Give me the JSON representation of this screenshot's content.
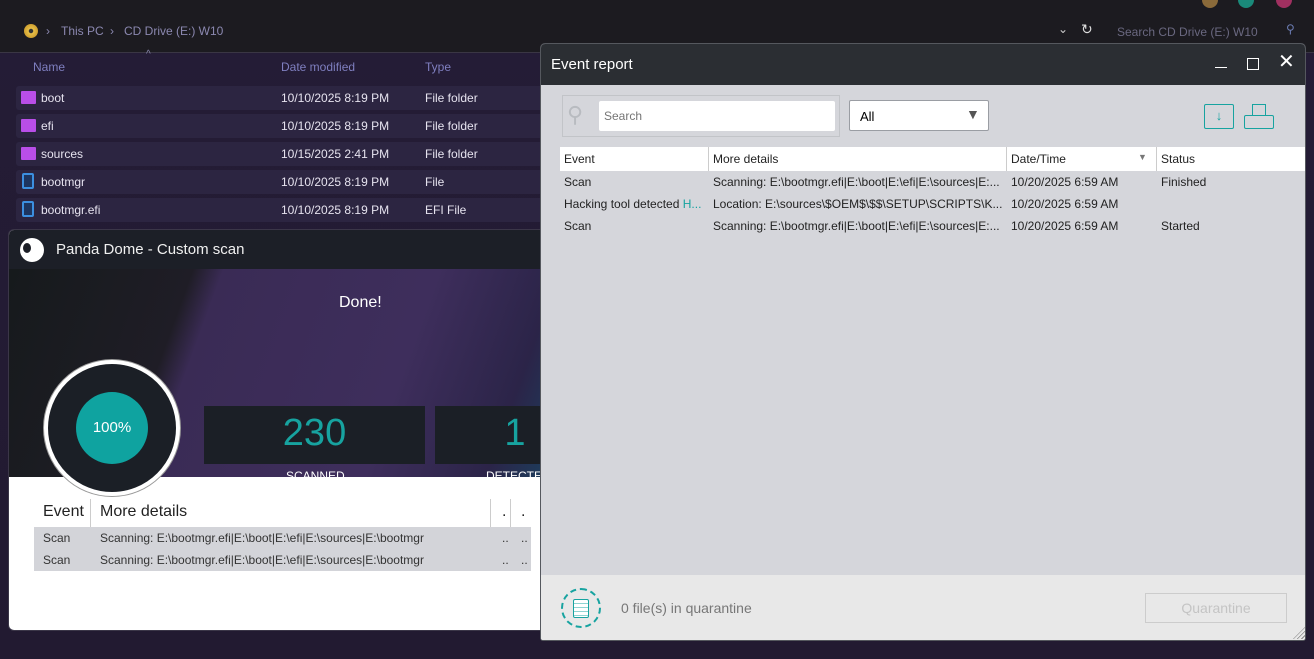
{
  "explorer": {
    "breadcrumb": [
      "This PC",
      "CD Drive (E:) W10"
    ],
    "search_placeholder": "Search CD Drive (E:) W10",
    "columns": [
      "Name",
      "Date modified",
      "Type"
    ],
    "files": [
      {
        "name": "boot",
        "date": "10/10/2025 8:19 PM",
        "type": "File folder",
        "icon": "folder-icon"
      },
      {
        "name": "efi",
        "date": "10/10/2025 8:19 PM",
        "type": "File folder",
        "icon": "folder-icon"
      },
      {
        "name": "sources",
        "date": "10/15/2025 2:41 PM",
        "type": "File folder",
        "icon": "folder-icon"
      },
      {
        "name": "bootmgr",
        "date": "10/10/2025 8:19 PM",
        "type": "File",
        "icon": "system-file-icon"
      },
      {
        "name": "bootmgr.efi",
        "date": "10/10/2025 8:19 PM",
        "type": "EFI File",
        "icon": "system-file-icon"
      }
    ]
  },
  "panda": {
    "title": "Panda Dome - Custom scan",
    "status": "Done!",
    "progress_label": "100%",
    "progress": 100,
    "scanned_value": "230",
    "scanned_label": "SCANNED",
    "detected_value": "1",
    "detected_label": "DETECTED",
    "table": {
      "columns": [
        "Event",
        "More details",
        ".",
        "."
      ],
      "rows": [
        {
          "event": "Scan",
          "details": "Scanning: E:\\bootmgr.efi|E:\\boot|E:\\efi|E:\\sources|E:\\bootmgr",
          "c3": "..",
          "c4": ".."
        },
        {
          "event": "Scan",
          "details": "Scanning: E:\\bootmgr.efi|E:\\boot|E:\\efi|E:\\sources|E:\\bootmgr",
          "c3": "..",
          "c4": ".."
        }
      ]
    }
  },
  "event_report": {
    "title": "Event report",
    "search_placeholder": "Search",
    "filter_value": "All",
    "columns": [
      "Event",
      "More details",
      "Date/Time",
      "Status"
    ],
    "rows": [
      {
        "event": "Scan",
        "event_link": "",
        "details": "Scanning: E:\\bootmgr.efi|E:\\boot|E:\\efi|E:\\sources|E:...",
        "datetime": "10/20/2025 6:59 AM",
        "status": "Finished"
      },
      {
        "event": "Hacking tool detected ",
        "event_link": "H...",
        "details": "Location: E:\\sources\\$OEM$\\$$\\SETUP\\SCRIPTS\\K...",
        "datetime": "10/20/2025 6:59 AM",
        "status": ""
      },
      {
        "event": "Scan",
        "event_link": "",
        "details": "Scanning: E:\\bootmgr.efi|E:\\boot|E:\\efi|E:\\sources|E:...",
        "datetime": "10/20/2025 6:59 AM",
        "status": "Started"
      }
    ],
    "quarantine_text": "0 file(s) in quarantine",
    "quarantine_button": "Quarantine"
  },
  "colors": {
    "accent": "#17a3a0",
    "folder": "#b94ee8"
  }
}
